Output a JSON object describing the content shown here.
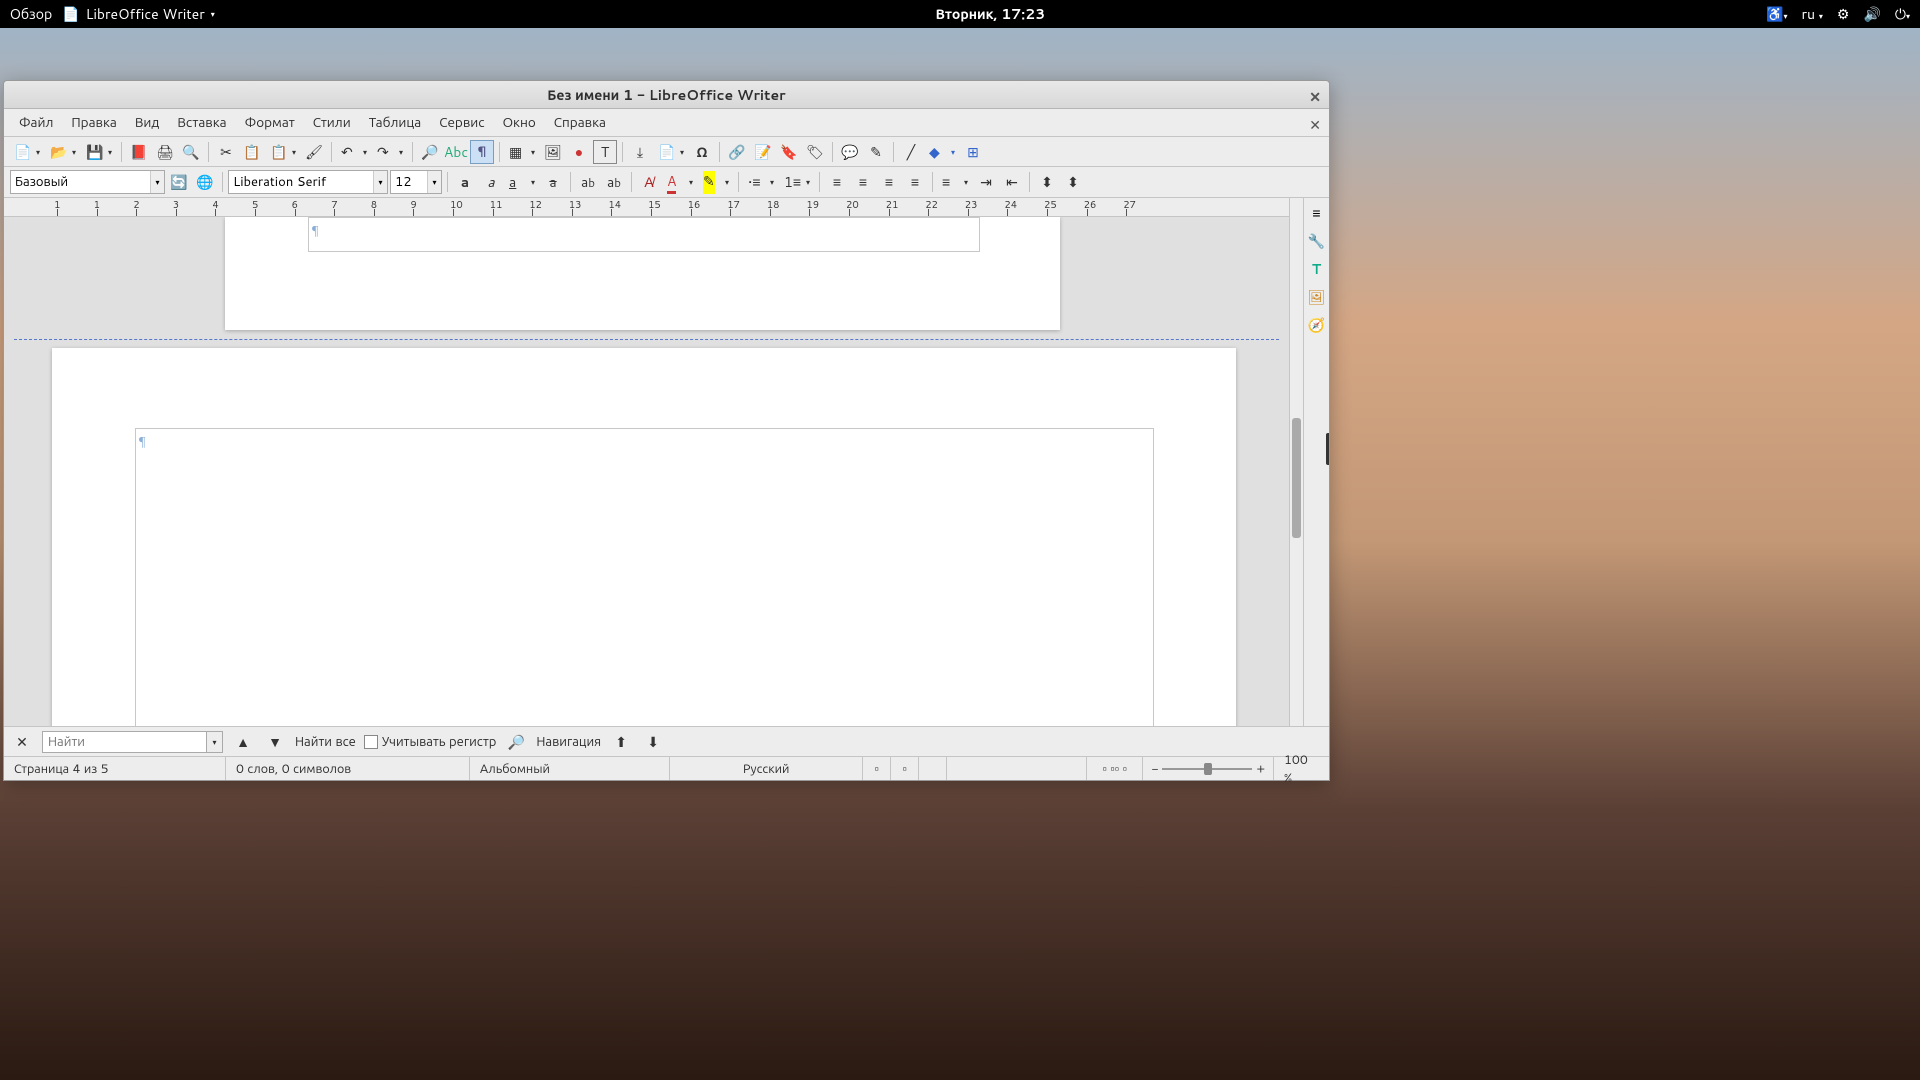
{
  "panel": {
    "overview": "Обзор",
    "app_name": "LibreOffice Writer",
    "clock": "Вторник, 17:23",
    "lang": "ru"
  },
  "window": {
    "title": "Без имени 1 - LibreOffice Writer"
  },
  "menu": {
    "file": "Файл",
    "edit": "Правка",
    "view": "Вид",
    "insert": "Вставка",
    "format": "Формат",
    "styles": "Стили",
    "table": "Таблица",
    "tools": "Сервис",
    "window": "Окно",
    "help": "Справка"
  },
  "formatting": {
    "para_style": "Базовый",
    "font_name": "Liberation Serif",
    "font_size": "12"
  },
  "ruler": {
    "marks": [
      "1",
      "1",
      "2",
      "3",
      "4",
      "5",
      "6",
      "7",
      "8",
      "9",
      "10",
      "11",
      "12",
      "13",
      "14",
      "15",
      "16",
      "17",
      "18",
      "19",
      "20",
      "21",
      "22",
      "23",
      "24",
      "25",
      "26",
      "27"
    ]
  },
  "document": {
    "pilcrow": "¶"
  },
  "find": {
    "placeholder": "Найти",
    "find_all": "Найти все",
    "match_case": "Учитывать регистр",
    "navigation": "Навигация"
  },
  "status": {
    "page": "Страница 4 из 5",
    "words": "0 слов, 0 символов",
    "page_style": "Альбомный",
    "language": "Русский",
    "zoom": "100 %"
  }
}
